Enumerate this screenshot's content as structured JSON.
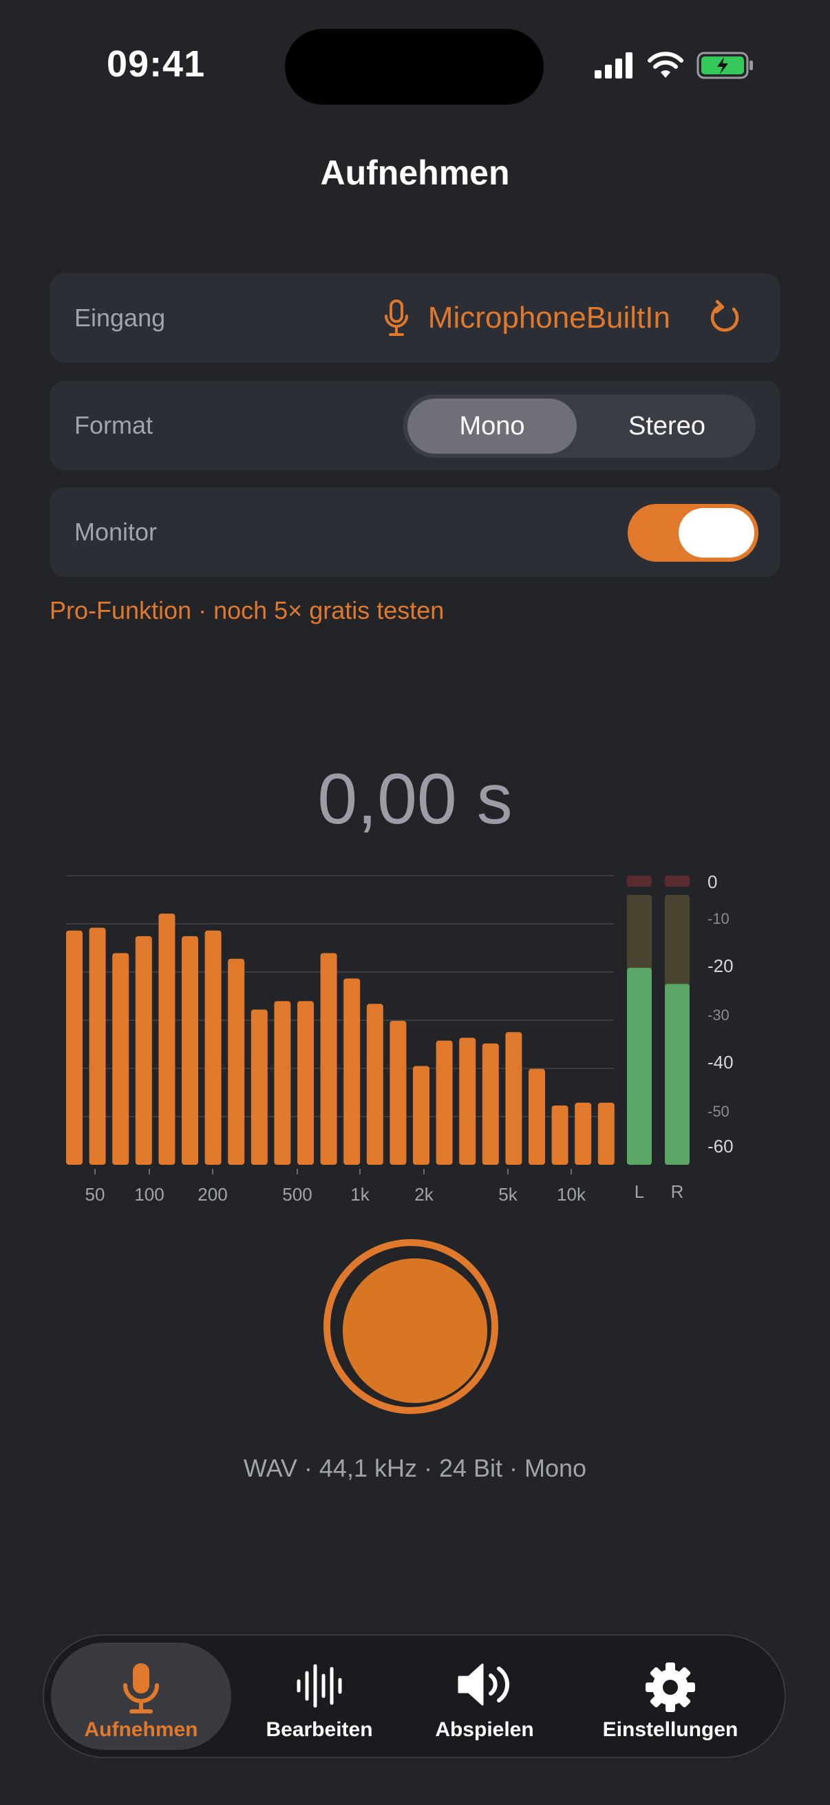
{
  "status": {
    "time": "09:41"
  },
  "title": "Aufnehmen",
  "input": {
    "label": "Eingang",
    "value": "MicrophoneBuiltIn"
  },
  "format": {
    "label": "Format",
    "options": [
      "Mono",
      "Stereo"
    ],
    "selected": "Mono"
  },
  "monitor": {
    "label": "Monitor",
    "enabled": true
  },
  "pro_note": "Pro-Funktion · noch 5× gratis testen",
  "timer": "0,00 s",
  "spectrum": {
    "freq_labels": [
      "50",
      "100",
      "200",
      "500",
      "1k",
      "2k",
      "5k",
      "10k"
    ],
    "bar_levels": [
      0.83,
      0.84,
      0.75,
      0.81,
      0.89,
      0.81,
      0.83,
      0.73,
      0.55,
      0.58,
      0.58,
      0.75,
      0.66,
      0.57,
      0.51,
      0.35,
      0.44,
      0.45,
      0.43,
      0.47,
      0.34,
      0.21,
      0.22,
      0.22
    ],
    "db_labels": [
      "0",
      "-10",
      "-20",
      "-30",
      "-40",
      "-50",
      "-60"
    ],
    "channel_labels": [
      "L",
      "R"
    ],
    "level_L": 0.73,
    "level_R": 0.67,
    "bar_color": "#e0792b",
    "level_color": "#5aa665"
  },
  "record_info": "WAV · 44,1 kHz · 24 Bit · Mono",
  "tabs": [
    {
      "label": "Aufnehmen",
      "icon": "mic-icon",
      "active": true
    },
    {
      "label": "Bearbeiten",
      "icon": "waveform-icon",
      "active": false
    },
    {
      "label": "Abspielen",
      "icon": "speaker-icon",
      "active": false
    },
    {
      "label": "Einstellungen",
      "icon": "gear-icon",
      "active": false
    }
  ],
  "colors": {
    "accent": "#e0792b",
    "background": "#232428",
    "card": "#2c2e35"
  }
}
